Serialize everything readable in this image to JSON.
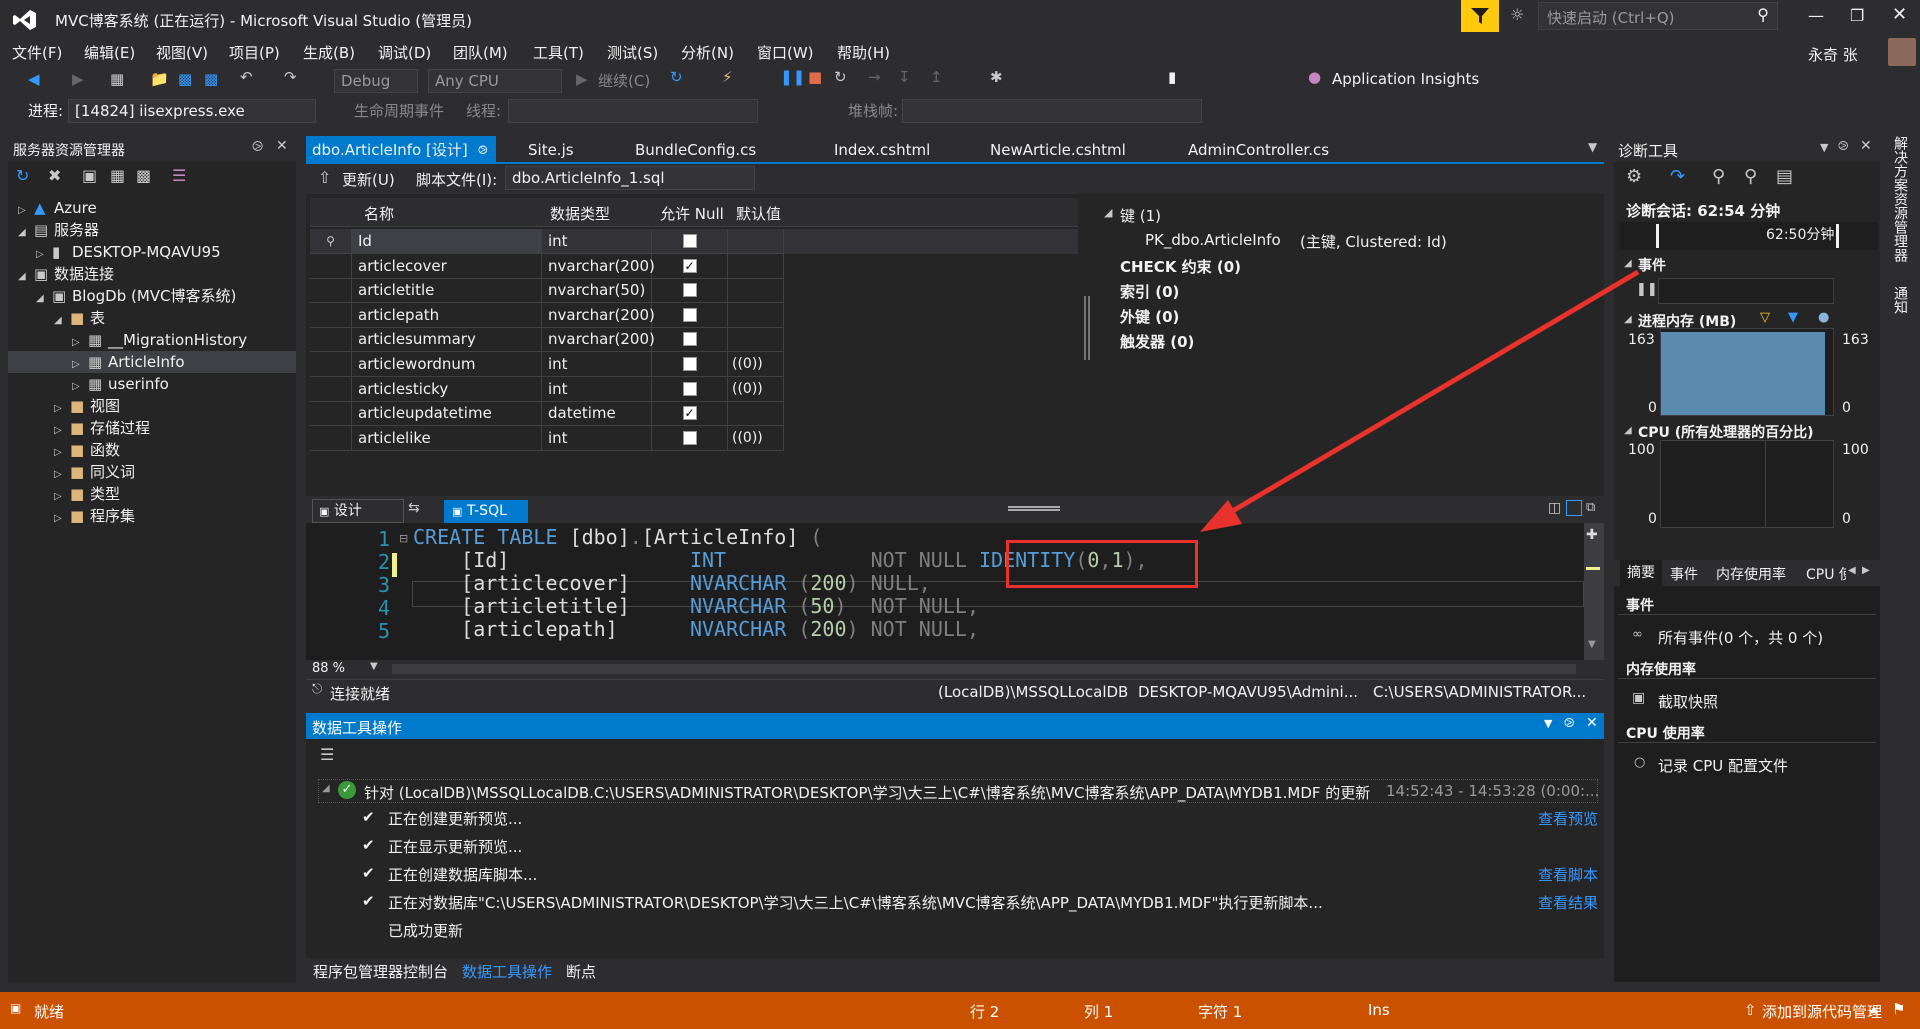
{
  "title": {
    "window_title": "MVC博客系统 (正在运行) - Microsoft Visual Studio (管理员)",
    "quick_launch_placeholder": "快速启动 (Ctrl+Q)",
    "user_name": "永奇 张"
  },
  "menu": [
    "文件(F)",
    "编辑(E)",
    "视图(V)",
    "项目(P)",
    "生成(B)",
    "调试(D)",
    "团队(M)",
    "工具(T)",
    "测试(S)",
    "分析(N)",
    "窗口(W)",
    "帮助(H)"
  ],
  "toolbar": {
    "config": "Debug",
    "platform": "Any CPU",
    "continue_label": "继续(C)",
    "app_insights": "Application Insights",
    "process_label": "进程:",
    "process_value": "[14824] iisexpress.exe",
    "lifecycle_label": "生命周期事件",
    "thread_label": "线程:",
    "stackframe_label": "堆栈帧:"
  },
  "server_explorer": {
    "title": "服务器资源管理器",
    "items": [
      {
        "label": "Azure",
        "level": 0,
        "icon": "azure-icon"
      },
      {
        "label": "服务器",
        "level": 0,
        "icon": "server-icon"
      },
      {
        "label": "DESKTOP-MQAVU95",
        "level": 1,
        "icon": "computer-icon"
      },
      {
        "label": "数据连接",
        "level": 0,
        "icon": "data-connection-icon"
      },
      {
        "label": "BlogDb (MVC博客系统)",
        "level": 1,
        "icon": "database-icon"
      },
      {
        "label": "表",
        "level": 2,
        "icon": "folder-icon"
      },
      {
        "label": "__MigrationHistory",
        "level": 3,
        "icon": "table-icon"
      },
      {
        "label": "ArticleInfo",
        "level": 3,
        "icon": "table-icon"
      },
      {
        "label": "userinfo",
        "level": 3,
        "icon": "table-icon"
      },
      {
        "label": "视图",
        "level": 2,
        "icon": "folder-icon"
      },
      {
        "label": "存储过程",
        "level": 2,
        "icon": "folder-icon"
      },
      {
        "label": "函数",
        "level": 2,
        "icon": "folder-icon"
      },
      {
        "label": "同义词",
        "level": 2,
        "icon": "folder-icon"
      },
      {
        "label": "类型",
        "level": 2,
        "icon": "folder-icon"
      },
      {
        "label": "程序集",
        "level": 2,
        "icon": "folder-icon"
      }
    ]
  },
  "tabs": [
    "dbo.ArticleInfo [设计]",
    "Site.js",
    "BundleConfig.cs",
    "Index.cshtml",
    "NewArticle.cshtml",
    "AdminController.cs"
  ],
  "designer": {
    "update_label": "更新(U)",
    "script_file_label": "脚本文件(I):",
    "script_file_value": "dbo.ArticleInfo_1.sql",
    "columns": [
      "名称",
      "数据类型",
      "允许 Null",
      "默认值"
    ],
    "rows": [
      {
        "name": "Id",
        "type": "int",
        "nullable": false,
        "default": ""
      },
      {
        "name": "articlecover",
        "type": "nvarchar(200)",
        "nullable": true,
        "default": ""
      },
      {
        "name": "articletitle",
        "type": "nvarchar(50)",
        "nullable": false,
        "default": ""
      },
      {
        "name": "articlepath",
        "type": "nvarchar(200)",
        "nullable": false,
        "default": ""
      },
      {
        "name": "articlesummary",
        "type": "nvarchar(200)",
        "nullable": false,
        "default": ""
      },
      {
        "name": "articlewordnum",
        "type": "int",
        "nullable": false,
        "default": "((0))"
      },
      {
        "name": "articlesticky",
        "type": "int",
        "nullable": false,
        "default": "((0))"
      },
      {
        "name": "articleupdatetime",
        "type": "datetime",
        "nullable": true,
        "default": ""
      },
      {
        "name": "articlelike",
        "type": "int",
        "nullable": false,
        "default": "((0))"
      }
    ],
    "props": {
      "keys": "键 (1)",
      "pk": "PK_dbo.ArticleInfo",
      "pk_detail": "(主键, Clustered: Id)",
      "check": "CHECK 约束 (0)",
      "index": "索引 (0)",
      "fk": "外键 (0)",
      "trigger": "触发器 (0)"
    },
    "pane_tabs": [
      "设计",
      "T-SQL"
    ]
  },
  "sql": {
    "lines": [
      {
        "n": "1",
        "text": "CREATE TABLE [dbo].[ArticleInfo] ("
      },
      {
        "n": "2",
        "text": "    [Id]               INT            NOT NULL IDENTITY(0,1),"
      },
      {
        "n": "3",
        "text": "    [articlecover]     NVARCHAR (200) NULL,"
      },
      {
        "n": "4",
        "text": "    [articletitle]     NVARCHAR (50)  NOT NULL,"
      },
      {
        "n": "5",
        "text": "    [articlepath]      NVARCHAR (200) NOT NULL,"
      }
    ],
    "zoom": "88 %"
  },
  "connbar": {
    "status": "连接就绪",
    "server": "(LocalDB)\\MSSQLLocalDB",
    "user": "DESKTOP-MQAVU95\\Admini...",
    "path": "C:\\USERS\\ADMINISTRATOR..."
  },
  "data_tools": {
    "title": "数据工具操作",
    "main": "针对 (LocalDB)\\MSSQLLocalDB.C:\\USERS\\ADMINISTRATOR\\DESKTOP\\学习\\大三上\\C#\\博客系统\\MVC博客系统\\APP_DATA\\MYDB1.MDF 的更新",
    "time": "14:52:43 - 14:53:28 (0:00:...",
    "steps": [
      {
        "text": "正在创建更新预览...",
        "link": "查看预览"
      },
      {
        "text": "正在显示更新预览...",
        "link": ""
      },
      {
        "text": "正在创建数据库脚本...",
        "link": "查看脚本"
      },
      {
        "text": "正在对数据库\"C:\\USERS\\ADMINISTRATOR\\DESKTOP\\学习\\大三上\\C#\\博客系统\\MVC博客系统\\APP_DATA\\MYDB1.MDF\"执行更新脚本...",
        "link": "查看结果"
      }
    ],
    "done": "已成功更新"
  },
  "bottom_tabs": [
    "程序包管理器控制台",
    "数据工具操作",
    "断点"
  ],
  "diag": {
    "title": "诊断工具",
    "session": "诊断会话: 62:54 分钟",
    "time_marker": "62:50分钟",
    "events": "事件",
    "memory": "进程内存 (MB)",
    "mem_max": "163",
    "mem_min": "0",
    "mem_level": 0.96,
    "cpu": "CPU (所有处理器的百分比)",
    "cpu_max": "100",
    "cpu_min": "0",
    "tabs": [
      "摘要",
      "事件",
      "内存使用率",
      "CPU 使"
    ],
    "sec_events": "事件",
    "events_item": "所有事件(0 个，共 0 个)",
    "sec_mem": "内存使用率",
    "snapshot": "截取快照",
    "sec_cpu": "CPU 使用率",
    "cpu_profile": "记录 CPU 配置文件"
  },
  "right_rail": [
    "解决方案资源管理器",
    "通知"
  ],
  "status": {
    "ready": "就绪",
    "row": "行 2",
    "col": "列 1",
    "char": "字符 1",
    "ins": "Ins",
    "source_control": "添加到源代码管理"
  },
  "colors": {
    "accent": "#007acc",
    "status_bar": "#ca5100",
    "annotation": "#e8322b"
  }
}
